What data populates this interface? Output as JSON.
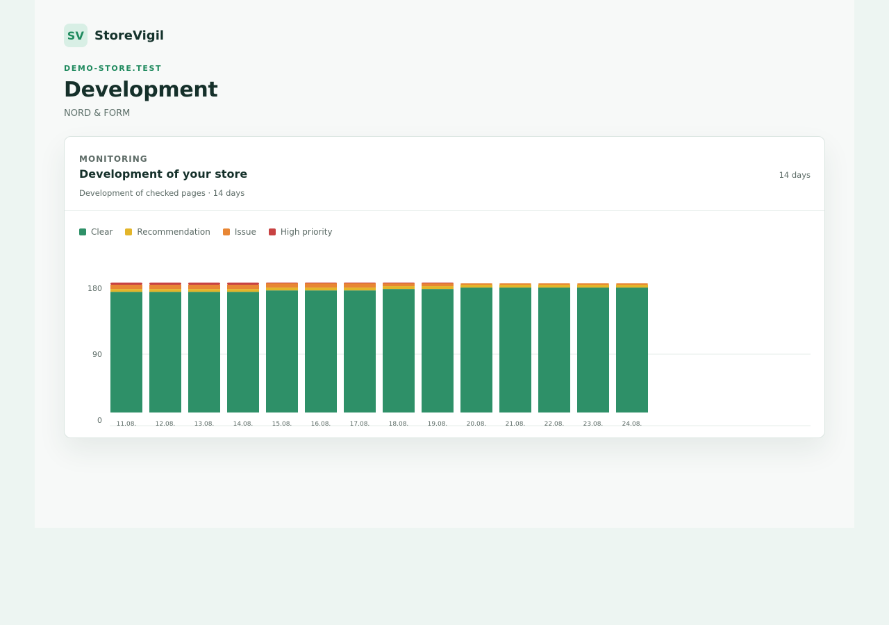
{
  "brand": {
    "logo_text": "SV",
    "name": "StoreVigil"
  },
  "header": {
    "eyebrow": "DEMO-STORE.TEST",
    "title": "Development",
    "subtitle": "NORD & FORM"
  },
  "card": {
    "eyebrow": "MONITORING",
    "title": "Development of your store",
    "description": "Development of checked pages · 14 days",
    "range": "14 days"
  },
  "legend": [
    {
      "label": "Clear",
      "color": "#2e9068"
    },
    {
      "label": "Recommendation",
      "color": "#e3b52a"
    },
    {
      "label": "Issue",
      "color": "#e88634"
    },
    {
      "label": "High priority",
      "color": "#c84242"
    }
  ],
  "chart_data": {
    "type": "bar",
    "stacked": true,
    "categories": [
      "11.08.",
      "12.08.",
      "13.08.",
      "14.08.",
      "15.08.",
      "16.08.",
      "17.08.",
      "18.08.",
      "19.08.",
      "20.08.",
      "21.08.",
      "22.08.",
      "23.08.",
      "24.08."
    ],
    "series": [
      {
        "name": "Clear",
        "color": "#2e9068",
        "values": [
          170,
          170,
          170,
          170,
          172,
          172,
          172,
          174,
          174,
          176,
          176,
          176,
          176,
          176
        ]
      },
      {
        "name": "Recommendation",
        "color": "#e3b52a",
        "values": [
          4,
          4,
          4,
          4,
          4,
          4,
          4,
          4,
          4,
          4,
          4,
          4,
          4,
          4
        ]
      },
      {
        "name": "Issue",
        "color": "#e88634",
        "values": [
          6,
          6,
          6,
          6,
          6,
          6,
          6,
          4,
          4,
          2,
          2,
          2,
          2,
          2
        ]
      },
      {
        "name": "High priority",
        "color": "#c84242",
        "values": [
          3,
          3,
          3,
          3,
          1,
          1,
          1,
          1,
          1,
          0,
          0,
          0,
          0,
          0
        ]
      }
    ],
    "yticks": [
      0,
      90,
      180
    ],
    "ylim": [
      0,
      180
    ],
    "grid": true,
    "legend_position": "top-left"
  }
}
